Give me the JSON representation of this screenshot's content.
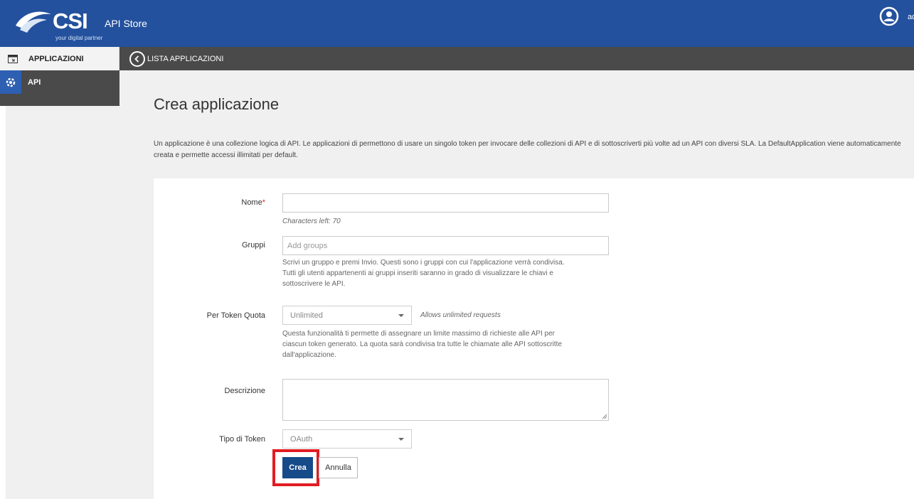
{
  "header": {
    "logo_text": "CSI",
    "logo_tagline": "your digital partner",
    "app_title": "API Store",
    "user_initial": "ad"
  },
  "sidebar": {
    "items": [
      {
        "label": "APPLICAZIONI",
        "icon": "window-icon"
      },
      {
        "label": "API",
        "icon": "gear-icon"
      }
    ]
  },
  "subbar": {
    "back_label": "LISTA APPLICAZIONI"
  },
  "page": {
    "title": "Crea applicazione",
    "description": "Un applicazione è una collezione logica di API. Le applicazioni di permettono di usare un singolo token per invocare delle collezioni di API e di sottoscriverti più volte ad un API con diversi SLA. La DefaultApplication viene automaticamente creata e permette accessi illimitati per default."
  },
  "form": {
    "nome": {
      "label": "Nome",
      "required_mark": "*",
      "value": "",
      "help": "Characters left: 70"
    },
    "gruppi": {
      "label": "Gruppi",
      "placeholder": "Add groups",
      "help_lines": [
        "Scrivi un gruppo e premi Invio. Questi sono i gruppi con cui l'applicazione verrà condivisa.",
        "Tutti gli utenti appartenenti ai gruppi inseriti saranno in grado di visualizzare le chiavi e",
        "sottoscrivere le API."
      ]
    },
    "quota": {
      "label": "Per Token Quota",
      "selected": "Unlimited",
      "note": "Allows unlimited requests",
      "help_lines": [
        "Questa funzionalità ti permette di assegnare un limite massimo di richieste alle API per",
        "ciascun token generato. La quota sarà condivisa tra tutte le chiamate alle API sottoscritte",
        "dall'applicazione."
      ]
    },
    "descrizione": {
      "label": "Descrizione",
      "value": ""
    },
    "tipo_token": {
      "label": "Tipo di Token",
      "selected": "OAuth"
    },
    "buttons": {
      "create": "Crea",
      "cancel": "Annulla"
    }
  },
  "colors": {
    "header_bg": "#24519d",
    "subbar_bg": "#4a4a4a",
    "primary_button": "#164b8a",
    "highlight": "#e11c22"
  }
}
